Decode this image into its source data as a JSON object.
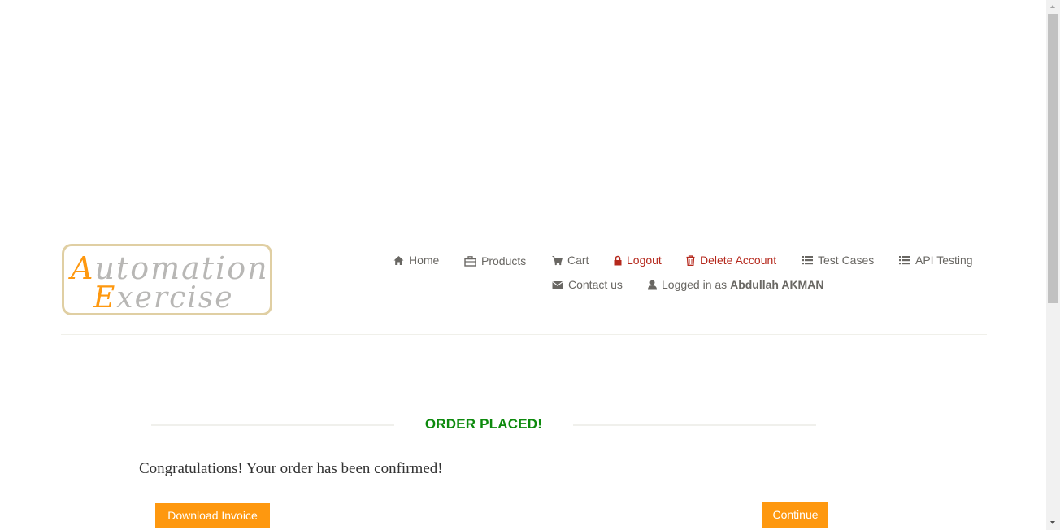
{
  "logo": {
    "line1_cap": "A",
    "line1_rest": "utomation",
    "line2_cap": "E",
    "line2_rest": "xercise"
  },
  "nav": {
    "home": "Home",
    "products": "Products",
    "cart": "Cart",
    "logout": "Logout",
    "delete_account": "Delete Account",
    "test_cases": "Test Cases",
    "api_testing": "API Testing",
    "contact_us": "Contact us",
    "logged_in_prefix": "Logged in as",
    "logged_in_user": "Abdullah AKMAN"
  },
  "main": {
    "title": "ORDER PLACED!",
    "message": "Congratulations! Your order has been confirmed!",
    "download_button": "Download Invoice",
    "continue_button": "Continue"
  },
  "colors": {
    "accent": "#fe980f",
    "success": "#0d8a0d",
    "danger": "#b5281c",
    "text": "#696763"
  },
  "icons": [
    "home-icon",
    "products-icon",
    "cart-icon",
    "lock-icon",
    "trash-icon",
    "list-icon",
    "list-icon",
    "envelope-icon",
    "user-icon"
  ]
}
